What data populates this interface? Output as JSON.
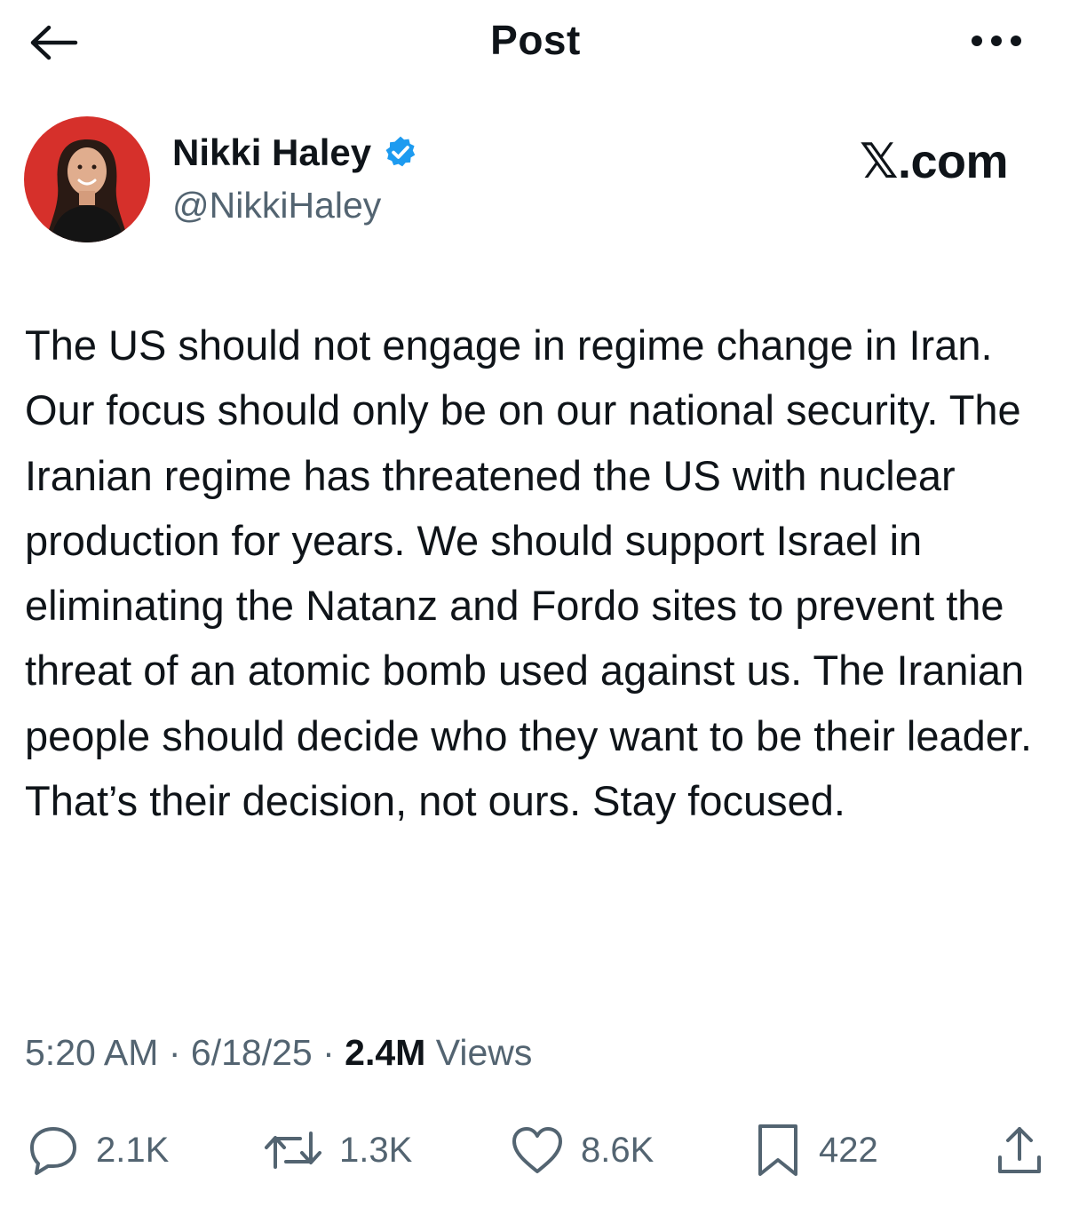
{
  "header": {
    "title": "Post",
    "back_icon": "arrow-left-icon",
    "more_icon": "more-horizontal-icon"
  },
  "author": {
    "display_name": "Nikki Haley",
    "handle": "@NikkiHaley",
    "verified": true,
    "verified_color": "#1d9bf0",
    "avatar_bg": "#d6302b"
  },
  "watermark": "𝕏.com",
  "post": {
    "text": "The US should not engage in regime change in Iran. Our focus should only be on our national security. The Iranian regime has threatened the US with nuclear production for years. We should support Israel in eliminating the Natanz and Fordo sites to prevent the threat of an atomic bomb used against us. The Iranian people should decide who they want to be their leader. That’s their decision, not ours. Stay focused.",
    "time": "5:20 AM",
    "date": "6/18/25",
    "separator": "·",
    "views_count": "2.4M",
    "views_label": "Views"
  },
  "actions": {
    "replies": "2.1K",
    "reposts": "1.3K",
    "likes": "8.6K",
    "bookmarks": "422"
  },
  "colors": {
    "text": "#0f1419",
    "secondary": "#536471"
  }
}
